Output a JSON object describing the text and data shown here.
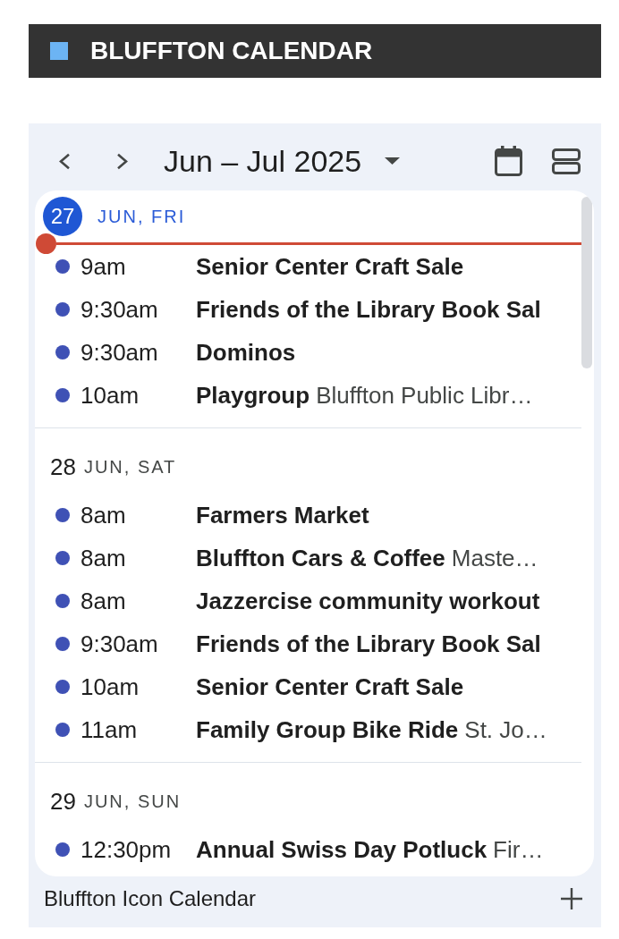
{
  "header": {
    "title": "BLUFFTON CALENDAR"
  },
  "toolbar": {
    "range": "Jun – Jul 2025"
  },
  "days": [
    {
      "day": "27",
      "label": "JUN, FRI",
      "today": true,
      "events": [
        {
          "time": "9am",
          "title": "Senior Center Craft Sale"
        },
        {
          "time": "9:30am",
          "title": "Friends of the Library Book Sal"
        },
        {
          "time": "9:30am",
          "title": "Dominos"
        },
        {
          "time": "10am",
          "title": "Playgroup",
          "location": "Bluffton Public Libr…"
        }
      ]
    },
    {
      "day": "28",
      "label": "JUN, SAT",
      "today": false,
      "events": [
        {
          "time": "8am",
          "title": "Farmers Market"
        },
        {
          "time": "8am",
          "title": "Bluffton Cars & Coffee",
          "location": "Maste…"
        },
        {
          "time": "8am",
          "title": "Jazzercise community workout"
        },
        {
          "time": "9:30am",
          "title": "Friends of the Library Book Sal"
        },
        {
          "time": "10am",
          "title": "Senior Center Craft Sale"
        },
        {
          "time": "11am",
          "title": "Family Group Bike Ride",
          "location": "St. Jo…"
        }
      ]
    },
    {
      "day": "29",
      "label": "JUN, SUN",
      "today": false,
      "events": [
        {
          "time": "12:30pm",
          "title": "Annual Swiss Day Potluck",
          "location": "Fir…"
        }
      ]
    }
  ],
  "footer": {
    "calendar_name": "Bluffton Icon Calendar"
  }
}
